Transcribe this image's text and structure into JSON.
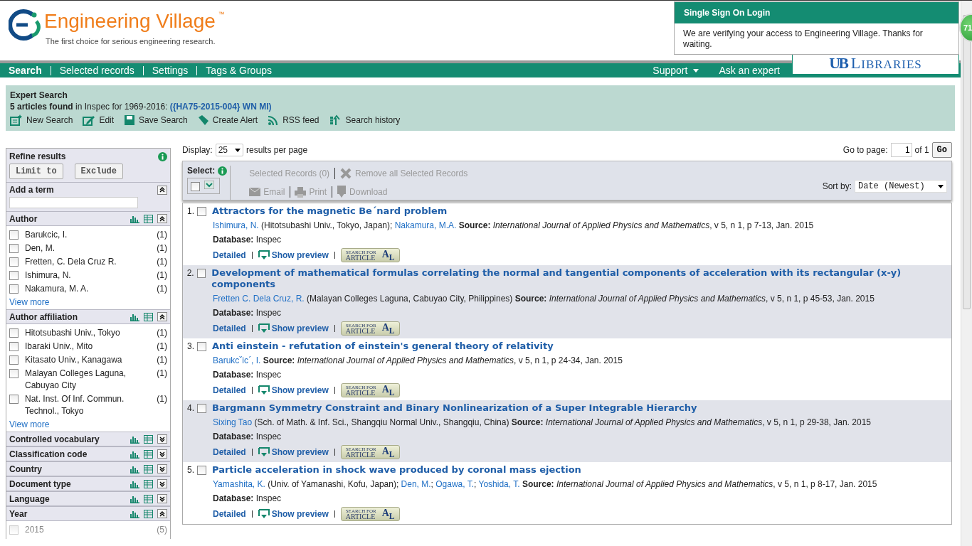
{
  "logo": {
    "name": "Engineering Village",
    "trademark": "™",
    "tagline": "The first choice for serious engineering research."
  },
  "nav": {
    "items": [
      {
        "label": "Search",
        "selected": true
      },
      {
        "label": "Selected records",
        "selected": false
      },
      {
        "label": "Settings",
        "selected": false
      },
      {
        "label": "Tags & Groups",
        "selected": false
      }
    ],
    "right": [
      {
        "label": "Support",
        "menu": true
      },
      {
        "label": "Ask an expert",
        "menu": false
      }
    ]
  },
  "library": {
    "mark": "UB",
    "name": "LIBRARIES"
  },
  "sso": {
    "title": "Single Sign On Login",
    "message": "We are verifying your access to Engineering Village. Thanks for waiting."
  },
  "badge": "71",
  "summary": {
    "title": "Expert Search",
    "found": "5 articles found",
    "context": " in Inspec for 1969-2016: ",
    "query": "({HA75-2015-004} WN MI)",
    "actions": [
      {
        "kind": "new",
        "label": "New Search"
      },
      {
        "kind": "edit",
        "label": "Edit"
      },
      {
        "kind": "save",
        "label": "Save Search"
      },
      {
        "kind": "alert",
        "label": "Create Alert"
      },
      {
        "kind": "rss",
        "label": "RSS feed"
      },
      {
        "kind": "history",
        "label": "Search history"
      }
    ]
  },
  "refine": {
    "title": "Refine results",
    "buttons": [
      "Limit to",
      "Exclude"
    ],
    "add_term": "Add a term",
    "facets": [
      {
        "title": "Author",
        "expanded": true,
        "more": "View more",
        "items": [
          {
            "label": "Barukcic, I.",
            "count": "(1)",
            "checked": false,
            "disabled": false
          },
          {
            "label": "Den, M.",
            "count": "(1)",
            "checked": false,
            "disabled": false
          },
          {
            "label": "Fretten, C. Dela Cruz R.",
            "count": "(1)",
            "checked": false,
            "disabled": false
          },
          {
            "label": "Ishimura, N.",
            "count": "(1)",
            "checked": false,
            "disabled": false
          },
          {
            "label": "Nakamura, M. A.",
            "count": "(1)",
            "checked": false,
            "disabled": false
          }
        ]
      },
      {
        "title": "Author affiliation",
        "expanded": true,
        "more": "View more",
        "items": [
          {
            "label": "Hitotsubashi Univ., Tokyo",
            "count": "(1)",
            "checked": false,
            "disabled": false
          },
          {
            "label": "Ibaraki Univ., Mito",
            "count": "(1)",
            "checked": false,
            "disabled": false
          },
          {
            "label": "Kitasato Univ., Kanagawa",
            "count": "(1)",
            "checked": false,
            "disabled": false
          },
          {
            "label": "Malayan Colleges Laguna, Cabuyao City",
            "count": "(1)",
            "checked": false,
            "disabled": false
          },
          {
            "label": "Nat. Inst. Of Inf. Commun. Technol., Tokyo",
            "count": "(1)",
            "checked": false,
            "disabled": false
          }
        ]
      },
      {
        "title": "Controlled vocabulary",
        "expanded": false
      },
      {
        "title": "Classification code",
        "expanded": false
      },
      {
        "title": "Country",
        "expanded": false
      },
      {
        "title": "Document type",
        "expanded": false
      },
      {
        "title": "Language",
        "expanded": false
      },
      {
        "title": "Year",
        "expanded": true,
        "items": [
          {
            "label": "2015",
            "count": "(5)",
            "checked": false,
            "disabled": true
          }
        ]
      }
    ]
  },
  "results": {
    "display_label": "Display:",
    "display_value": "25",
    "display_suffix": "results per page",
    "goto_label": "Go to page:",
    "goto_value": "1",
    "goto_of": "of 1",
    "go": "Go",
    "select_label": "Select:",
    "toolbar": [
      {
        "kind": "count",
        "label": "Selected Records (0)",
        "disabled": true
      },
      {
        "kind": "remove",
        "label": "Remove all Selected Records",
        "disabled": true
      }
    ],
    "toolbar2": [
      {
        "kind": "email",
        "label": "Email",
        "disabled": true
      },
      {
        "kind": "print",
        "label": "Print",
        "disabled": true
      },
      {
        "kind": "download",
        "label": "Download",
        "disabled": true
      }
    ],
    "sort_label": "Sort by:",
    "sort_value": "Date (Newest)",
    "records": [
      {
        "number": "1.",
        "checked": false,
        "title": "Attractors for the magnetic Be´nard problem",
        "authors": [
          {
            "text": "Ishimura, N.",
            "link": true
          },
          {
            "text": " (Hitotsubashi Univ., Tokyo, Japan); ",
            "link": false
          },
          {
            "text": "Nakamura, M.A.",
            "link": true
          }
        ],
        "source": "**Source:** *International Journal of Applied Physics and Mathematics*, v 5, n 1, p 7-13, Jan. 2015",
        "database_label": "Database:",
        "database": "Inspec",
        "detailed": "Detailed",
        "preview": "Show preview",
        "article": {
          "top": "SEARCH FOR",
          "bottom": "ARTICLE",
          "mark": "A$_{L}$"
        }
      },
      {
        "number": "2.",
        "checked": false,
        "title": "Development of mathematical formulas correlating the normal and tangential components of acceleration with its rectangular (x-y) components",
        "authors": [
          {
            "text": "Fretten C. Dela Cruz, R.",
            "link": true
          },
          {
            "text": " (Malayan Colleges Laguna, Cabuyao City, Philippines) ",
            "link": false
          }
        ],
        "source": "**Source:** *International Journal of Applied Physics and Mathematics*, v 5, n 1, p 45-53, Jan. 2015",
        "database_label": "Database:",
        "database": "Inspec",
        "detailed": "Detailed",
        "preview": "Show preview",
        "article": {
          "top": "SEARCH FOR",
          "bottom": "ARTICLE",
          "mark": "A$_{L}$"
        }
      },
      {
        "number": "3.",
        "checked": false,
        "title": "Anti einstein - refutation of einstein's general theory of relativity",
        "authors": [
          {
            "text": "Barukcˇicˊ, I.",
            "link": true
          }
        ],
        "source": "**Source:** *International Journal of Applied Physics and Mathematics*, v 5, n 1, p 24-34, Jan. 2015",
        "database_label": "Database:",
        "database": "Inspec",
        "detailed": "Detailed",
        "preview": "Show preview",
        "article": {
          "top": "SEARCH FOR",
          "bottom": "ARTICLE",
          "mark": "A$_{L}$"
        }
      },
      {
        "number": "4.",
        "checked": false,
        "title": "Bargmann Symmetry Constraint and Binary Nonlinearization of a Super Integrable Hierarchy",
        "authors": [
          {
            "text": "Sixing Tao",
            "link": true
          },
          {
            "text": " (Sch. of Math. & Inf. Sci., Shangqiu Normal Univ., Shangqiu, China) ",
            "link": false
          }
        ],
        "source": "**Source:** *International Journal of Applied Physics and Mathematics*, v 5, n 1, p 29-38, Jan. 2015",
        "database_label": "Database:",
        "database": "Inspec",
        "detailed": "Detailed",
        "preview": "Show preview",
        "article": {
          "top": "SEARCH FOR",
          "bottom": "ARTICLE",
          "mark": "A$_{L}$"
        }
      },
      {
        "number": "5.",
        "checked": false,
        "title": "Particle acceleration in shock wave produced by coronal mass ejection",
        "authors": [
          {
            "text": "Yamashita, K.",
            "link": true
          },
          {
            "text": " (Univ. of Yamanashi, Kofu, Japan); ",
            "link": false
          },
          {
            "text": "Den, M.",
            "link": true
          },
          {
            "text": "; ",
            "link": false
          },
          {
            "text": "Ogawa, T.",
            "link": true
          },
          {
            "text": "; ",
            "link": false
          },
          {
            "text": "Yoshida, T.",
            "link": true
          }
        ],
        "source": "**Source:** *International Journal of Applied Physics and Mathematics*, v 5, n 1, p 8-17, Jan. 2015",
        "database_label": "Database:",
        "database": "Inspec",
        "detailed": "Detailed",
        "preview": "Show preview",
        "article": {
          "top": "SEARCH FOR",
          "bottom": "ARTICLE",
          "mark": "A$_{L}$"
        }
      }
    ]
  }
}
